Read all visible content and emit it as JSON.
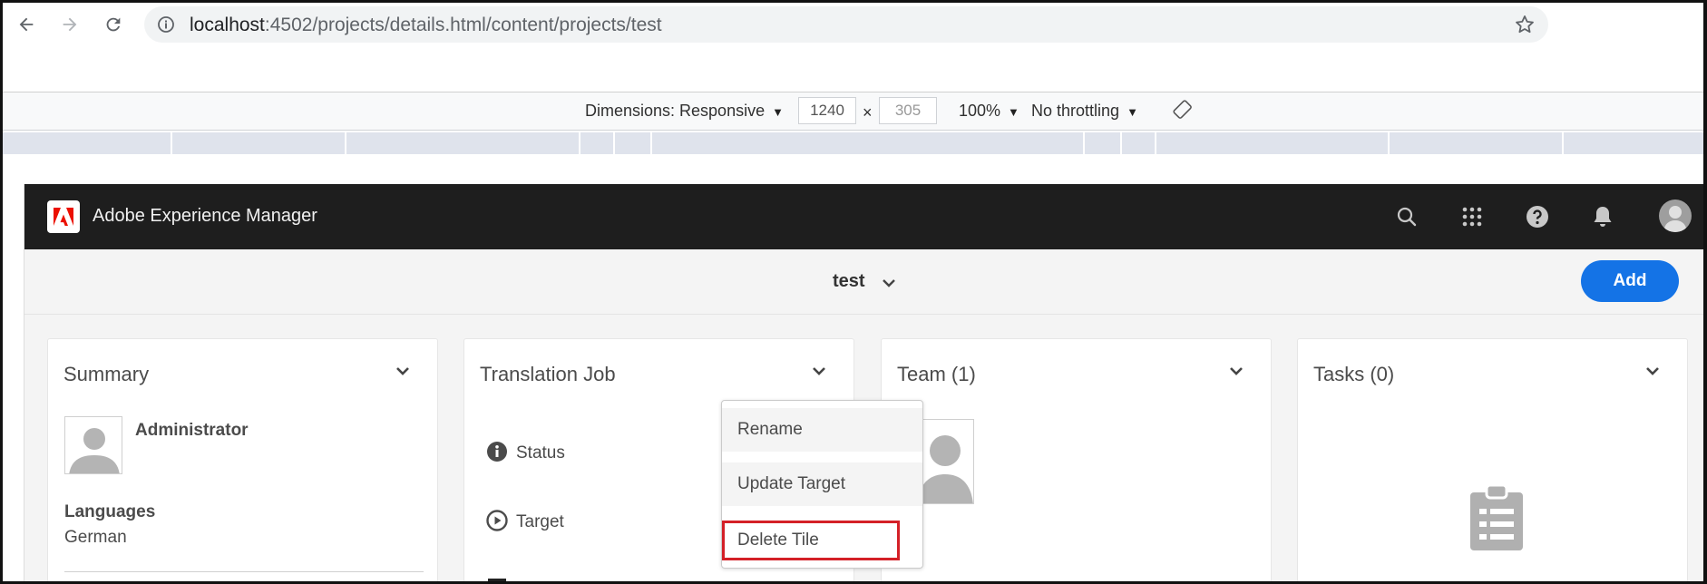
{
  "browser": {
    "url_host": "localhost",
    "url_rest": ":4502/projects/details.html/content/projects/test",
    "back_icon": "back-arrow-icon",
    "forward_icon": "forward-arrow-icon",
    "reload_icon": "reload-icon",
    "info_icon": "info-circle-icon",
    "bookmark_icon": "star-icon"
  },
  "devtools": {
    "dimensions_label": "Dimensions: Responsive",
    "width_value": "1240",
    "times": "×",
    "height_value": "305",
    "zoom": "100%",
    "throttling": "No throttling",
    "rotate_icon": "rotate-icon"
  },
  "aem": {
    "app_title": "Adobe Experience Manager",
    "brand_color": "#eb1000",
    "page_title": "test",
    "add_label": "Add",
    "accent_color": "#1473e6"
  },
  "cards": {
    "summary": {
      "title": "Summary",
      "owner": "Administrator",
      "languages_label": "Languages",
      "languages_value": "German"
    },
    "translation": {
      "title": "Translation Job",
      "status_label": "Status",
      "target_label": "Target"
    },
    "team": {
      "title": "Team (1)"
    },
    "tasks": {
      "title": "Tasks (0)"
    }
  },
  "menu": {
    "items": [
      "Rename",
      "Update Target",
      "Delete Tile"
    ],
    "highlight_color": "#d42027"
  }
}
